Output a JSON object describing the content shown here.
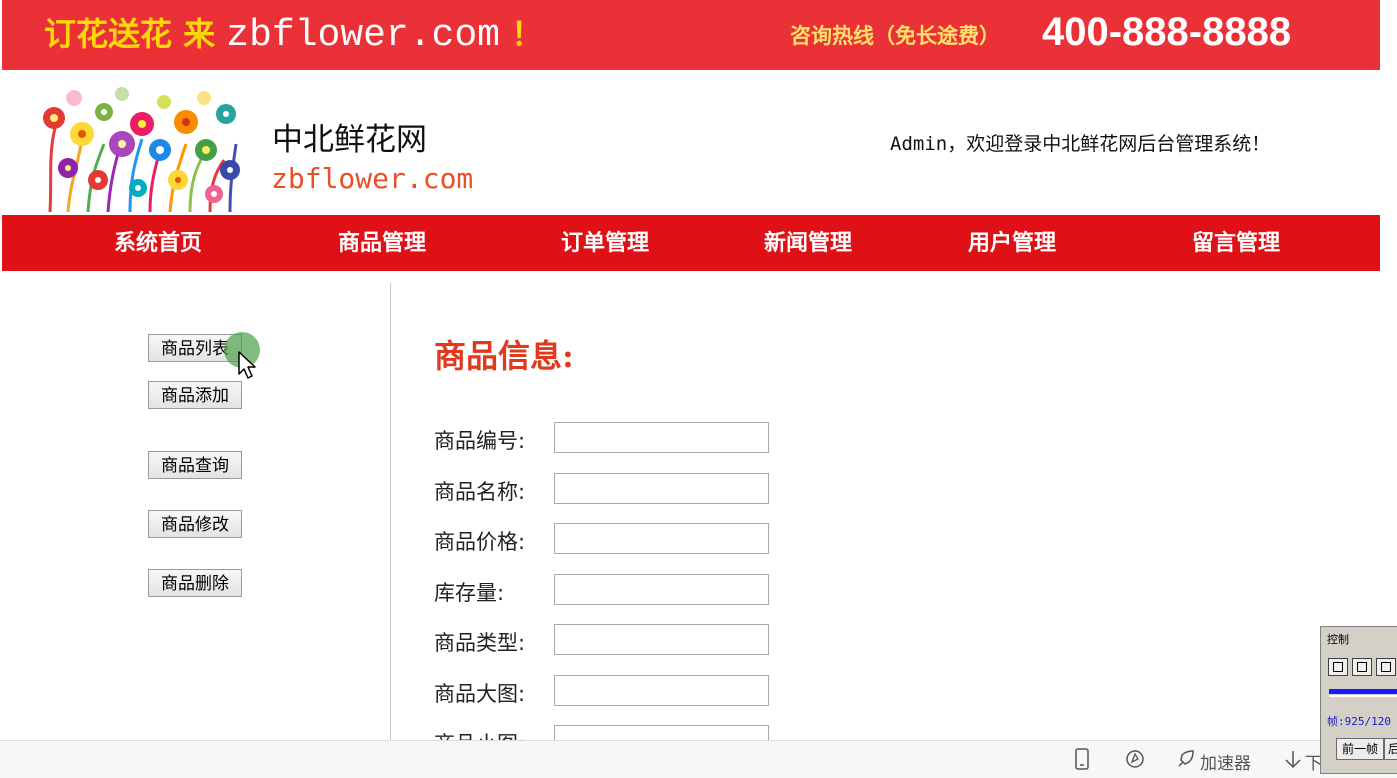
{
  "banner": {
    "slogan_cn": "订花送花 来 ",
    "slogan_site": "zbflower.com",
    "slogan_bang": " ！",
    "hotline_label": "咨询热线（免长途费）",
    "hotline_number": "400-888-8888"
  },
  "brand": {
    "name_cn": "中北鲜花网",
    "name_en": "zbflower.com"
  },
  "welcome": "Admin，欢迎登录中北鲜花网后台管理系统！",
  "nav": {
    "items": [
      {
        "label": "系统首页"
      },
      {
        "label": "商品管理"
      },
      {
        "label": "订单管理"
      },
      {
        "label": "新闻管理"
      },
      {
        "label": "用户管理"
      },
      {
        "label": "留言管理"
      }
    ]
  },
  "sidebar": {
    "buttons": [
      {
        "label": "商品列表"
      },
      {
        "label": "商品添加"
      },
      {
        "label": "商品查询"
      },
      {
        "label": "商品修改"
      },
      {
        "label": "商品删除"
      }
    ]
  },
  "content": {
    "title": "商品信息:",
    "fields": [
      {
        "label": "商品编号:",
        "value": ""
      },
      {
        "label": "商品名称:",
        "value": ""
      },
      {
        "label": "商品价格:",
        "value": ""
      },
      {
        "label": "库存量:",
        "value": ""
      },
      {
        "label": "商品类型:",
        "value": ""
      },
      {
        "label": "商品大图:",
        "value": ""
      },
      {
        "label": "商品小图:",
        "value": ""
      }
    ]
  },
  "browser_bar": {
    "accelerator_label": "加速器",
    "download_label": "下"
  },
  "control_window": {
    "title": "控制",
    "frame_readout": "帧:925/120",
    "prev_frame_label": "前一帧",
    "next_frame_label": "后"
  },
  "colors": {
    "banner_bg": "#ea3137",
    "nav_bg": "#df1116",
    "slogan": "#ffd80a",
    "brand_en": "#e8502a",
    "title": "#e03a1e"
  }
}
